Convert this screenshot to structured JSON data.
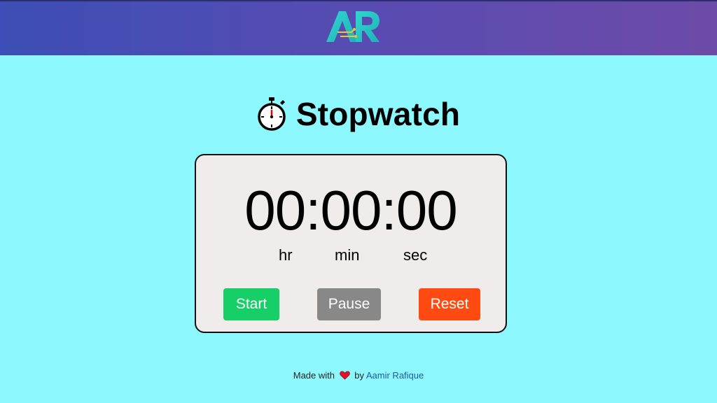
{
  "header": {
    "logo_text": "AR"
  },
  "app": {
    "title": "Stopwatch",
    "title_icon": "stopwatch-icon"
  },
  "timer": {
    "display": "00:00:00",
    "units": {
      "hr": "hr",
      "min": "min",
      "sec": "sec"
    }
  },
  "controls": {
    "start_label": "Start",
    "pause_label": "Pause",
    "reset_label": "Reset"
  },
  "footer": {
    "made_with": "Made with",
    "by": "by",
    "author": "Aamir Rafique",
    "heart_icon": "heart-icon"
  },
  "colors": {
    "page_background": "#8df9ff",
    "header_gradient_start": "#3d4fb6",
    "header_gradient_end": "#6d4ba8",
    "card_background": "#efeceb",
    "start_button": "#16cf66",
    "pause_button": "#888888",
    "reset_button": "#ff4b12",
    "author_link": "#1f5aa8"
  }
}
